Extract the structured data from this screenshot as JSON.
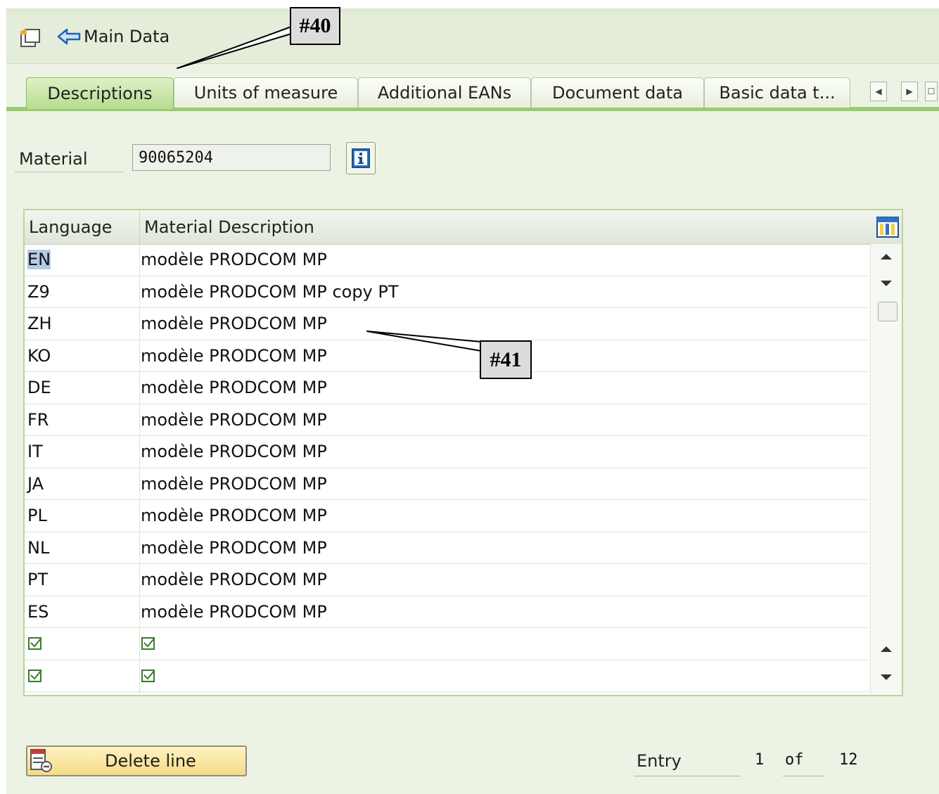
{
  "toolbar": {
    "back_label": "Main Data"
  },
  "tabs": [
    {
      "label": "Descriptions",
      "active": true
    },
    {
      "label": "Units of measure",
      "active": false
    },
    {
      "label": "Additional EANs",
      "active": false
    },
    {
      "label": "Document data",
      "active": false
    },
    {
      "label": "Basic data t...",
      "active": false
    }
  ],
  "material": {
    "label": "Material",
    "value": "90065204"
  },
  "table": {
    "columns": [
      "Language",
      "Material Description"
    ],
    "rows": [
      {
        "lang": "EN",
        "desc": "modèle PRODCOM MP"
      },
      {
        "lang": "Z9",
        "desc": "modèle PRODCOM MP copy PT"
      },
      {
        "lang": "ZH",
        "desc": "modèle PRODCOM MP"
      },
      {
        "lang": "KO",
        "desc": "modèle PRODCOM MP"
      },
      {
        "lang": "DE",
        "desc": "modèle PRODCOM MP"
      },
      {
        "lang": "FR",
        "desc": "modèle PRODCOM MP"
      },
      {
        "lang": "IT",
        "desc": "modèle PRODCOM MP"
      },
      {
        "lang": "JA",
        "desc": "modèle PRODCOM MP"
      },
      {
        "lang": "PL",
        "desc": "modèle PRODCOM MP"
      },
      {
        "lang": "NL",
        "desc": "modèle PRODCOM MP"
      },
      {
        "lang": "PT",
        "desc": "modèle PRODCOM MP"
      },
      {
        "lang": "ES",
        "desc": "modèle PRODCOM MP"
      }
    ],
    "empty_rows": 2
  },
  "footer": {
    "delete_label": "Delete line",
    "entry_label": "Entry",
    "entry_current": "1",
    "entry_of": "of",
    "entry_total": "12"
  },
  "callouts": {
    "first": "#40",
    "second": "#41"
  },
  "colors": {
    "background": "#ecf3e5",
    "active_tab": "#b6dc8f",
    "button": "#f5db86",
    "selection": "#b5cbe6"
  }
}
